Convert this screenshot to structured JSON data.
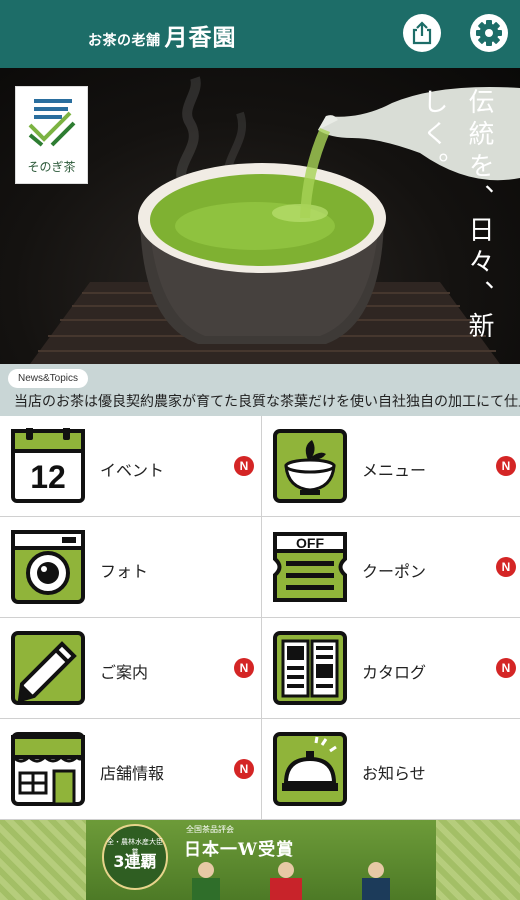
{
  "header": {
    "brand_small": "お茶の老舗",
    "brand_big": "月香園",
    "share_icon": "share-icon",
    "settings_icon": "gear-icon",
    "bg_color": "#1d6d68"
  },
  "hero": {
    "logo_caption": "そのぎ茶",
    "slogan": "伝統を、日々、新しく。"
  },
  "news": {
    "label": "News&Topics",
    "ticker": "当店のお茶は優良契約農家が育てた良質な茶葉だけを使い自社独自の加工にて仕上げております。"
  },
  "menu": [
    {
      "label": "イベント",
      "icon": "calendar-icon",
      "badge": "N"
    },
    {
      "label": "メニュー",
      "icon": "tea-bowl-icon",
      "badge": "N"
    },
    {
      "label": "フォト",
      "icon": "camera-icon",
      "badge": ""
    },
    {
      "label": "クーポン",
      "icon": "coupon-icon",
      "badge": "N",
      "icon_text": "OFF"
    },
    {
      "label": "ご案内",
      "icon": "pencil-note-icon",
      "badge": "N"
    },
    {
      "label": "カタログ",
      "icon": "catalog-icon",
      "badge": "N"
    },
    {
      "label": "店舗情報",
      "icon": "shop-icon",
      "badge": "N"
    },
    {
      "label": "お知らせ",
      "icon": "service-bell-icon",
      "badge": ""
    }
  ],
  "calendar_day": "12",
  "banner": {
    "badge_top": "全・農林水産大臣賞",
    "badge_main": "3連覇",
    "badge_bottom": "",
    "award_top": "全国茶品評会",
    "award_main": "日本一W受賞"
  },
  "colors": {
    "accent_green": "#90b43a",
    "badge_red": "#d42525",
    "news_bg": "#c9d6d6"
  }
}
